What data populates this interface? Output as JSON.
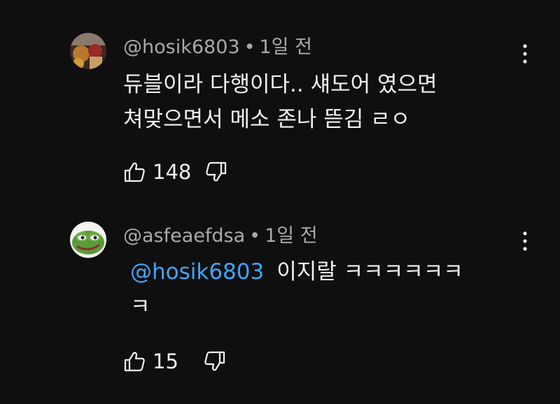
{
  "comments": [
    {
      "author": "@hosik6803",
      "time": "1일 전",
      "text_lines": [
        "듀블이라 다행이다.. 섀도어 였으면",
        "쳐맞으면서 메소 존나 뜯김 ㄹㅇ"
      ],
      "likes": "148",
      "avatar_icon": "photo-avatar",
      "colors": {
        "avatar_bg": "#6b3a2a"
      }
    },
    {
      "author": "@asfeaefdsa",
      "time": "1일 전",
      "mention": "@hosik6803",
      "text_lines": [
        "이지랄 ㅋㅋㅋㅋㅋㅋ",
        "ㅋ"
      ],
      "likes": "15",
      "avatar_icon": "pepe-frog-avatar",
      "colors": {
        "mention": "#3ea6ff"
      }
    }
  ],
  "separator": "•",
  "icons": {
    "like": "thumbs-up-icon",
    "dislike": "thumbs-down-icon",
    "menu": "more-vert-icon"
  }
}
